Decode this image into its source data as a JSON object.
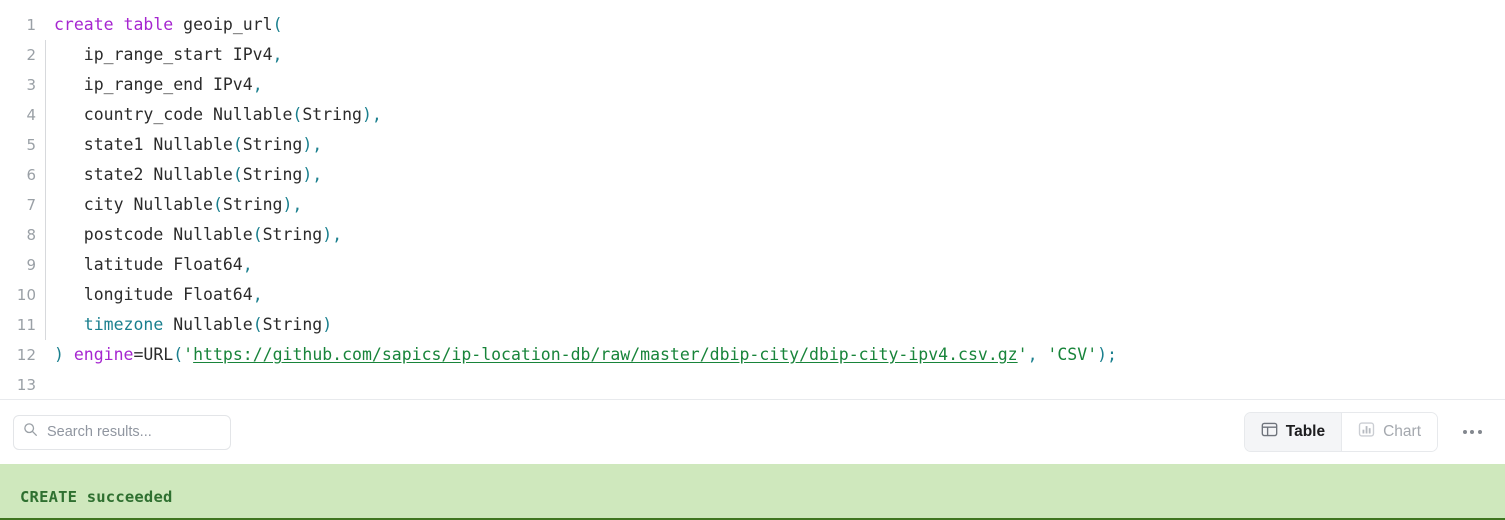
{
  "editor": {
    "language": "sql",
    "total_lines": 13,
    "lines": [
      {
        "num": "1",
        "indent_guide": false,
        "text": "create table geoip_url("
      },
      {
        "num": "2",
        "indent_guide": true,
        "text": "    ip_range_start IPv4,"
      },
      {
        "num": "3",
        "indent_guide": true,
        "text": "    ip_range_end IPv4,"
      },
      {
        "num": "4",
        "indent_guide": true,
        "text": "    country_code Nullable(String),"
      },
      {
        "num": "5",
        "indent_guide": true,
        "text": "    state1 Nullable(String),"
      },
      {
        "num": "6",
        "indent_guide": true,
        "text": "    state2 Nullable(String),"
      },
      {
        "num": "7",
        "indent_guide": true,
        "text": "    city Nullable(String),"
      },
      {
        "num": "8",
        "indent_guide": true,
        "text": "    postcode Nullable(String),"
      },
      {
        "num": "9",
        "indent_guide": true,
        "text": "    latitude Float64,"
      },
      {
        "num": "10",
        "indent_guide": true,
        "text": "    longitude Float64,"
      },
      {
        "num": "11",
        "indent_guide": true,
        "text": "    timezone Nullable(String)"
      },
      {
        "num": "12",
        "indent_guide": false,
        "text": ") engine=URL('https://github.com/sapics/ip-location-db/raw/master/dbip-city/dbip-city-ipv4.csv.gz', 'CSV');"
      },
      {
        "num": "13",
        "indent_guide": false,
        "text": ""
      }
    ],
    "url_value": "https://github.com/sapics/ip-location-db/raw/master/dbip-city/dbip-city-ipv4.csv.gz",
    "format_value": "CSV",
    "table_name": "geoip_url",
    "keywords": [
      "create",
      "table",
      "engine"
    ],
    "colors": {
      "keyword": "#a626d0",
      "punctuation": "#1a7f8e",
      "identifier": "#2b2b2b",
      "string": "#18843a",
      "gutter_number": "#9aa0a6",
      "indent_guide": "#d7d9dc"
    }
  },
  "results_toolbar": {
    "search": {
      "placeholder": "Search results...",
      "value": "",
      "icon": "search-icon"
    },
    "view_toggle": {
      "options": [
        {
          "id": "table",
          "label": "Table",
          "icon": "table-layout-icon",
          "active": true
        },
        {
          "id": "chart",
          "label": "Chart",
          "icon": "bar-chart-icon",
          "active": false
        }
      ]
    },
    "more": {
      "label": "•••",
      "icon": "ellipsis-horizontal-icon"
    }
  },
  "status": {
    "message": "CREATE succeeded",
    "kind": "success",
    "background": "#cfe8bd",
    "text_color": "#2f7030",
    "border_color": "#3f7520"
  }
}
